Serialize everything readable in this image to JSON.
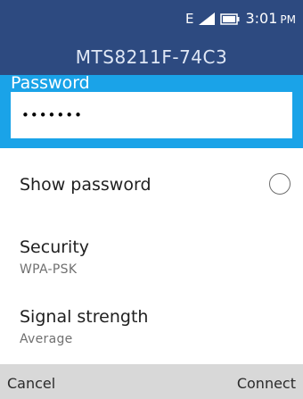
{
  "status_bar": {
    "network_type": "E",
    "signal_icon": "signal-icon",
    "battery_icon": "battery-icon",
    "time": "3:01",
    "ampm": "PM"
  },
  "header": {
    "title": "MTS8211F-74C3"
  },
  "password": {
    "label": "Password",
    "value": "•••••••"
  },
  "show_password": {
    "label": "Show password",
    "checked": false,
    "icon": "radio-unchecked-icon"
  },
  "security": {
    "label": "Security",
    "value": "WPA-PSK"
  },
  "signal_strength": {
    "label": "Signal strength",
    "value": "Average"
  },
  "softkeys": {
    "left": "Cancel",
    "right": "Connect"
  },
  "colors": {
    "header_bg": "#2d4a80",
    "focus_bg": "#1aa3e8",
    "softkey_bg": "#d8d8d8"
  }
}
